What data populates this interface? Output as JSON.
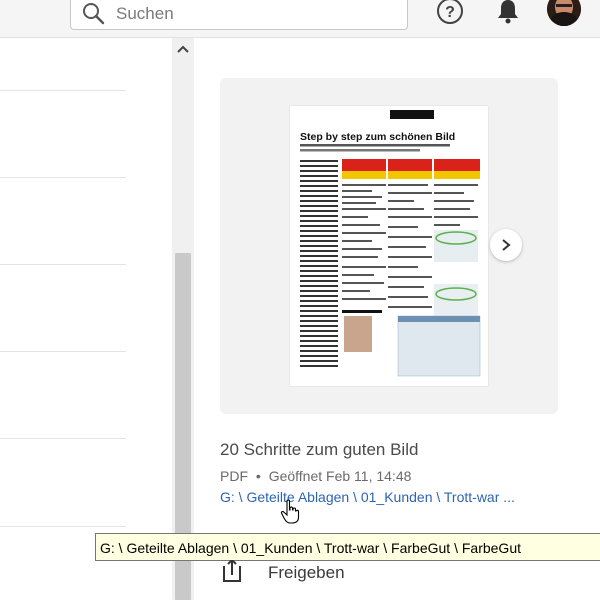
{
  "search": {
    "placeholder": "Suchen"
  },
  "icons": {
    "search": "search-icon",
    "help": "help-icon",
    "notifications": "bell-icon",
    "avatar": "avatar",
    "scroll_up": "chevron-up-icon",
    "next": "chevron-right-icon",
    "share": "share-icon",
    "cursor": "hand-pointer-icon"
  },
  "document": {
    "title": "20 Schritte zum guten Bild",
    "type": "PDF",
    "separator": "•",
    "opened": "Geöffnet Feb 11, 14:48",
    "path_short": "G: \\ Geteilte Ablagen \\ 01_Kunden \\ Trott-war ...",
    "thumbnail_heading": "Step by step zum schönen Bild"
  },
  "tooltip": {
    "text": "G: \\ Geteilte Ablagen \\ 01_Kunden \\ Trott-war \\ FarbeGut \\ FarbeGut"
  },
  "actions": {
    "share_label": "Freigeben"
  },
  "colors": {
    "link": "#2d64b3",
    "tooltip_bg": "#ffffe1",
    "panel_bg": "#f2f2f2",
    "thumb_red": "#d9231a",
    "thumb_yellow": "#f2c500"
  }
}
